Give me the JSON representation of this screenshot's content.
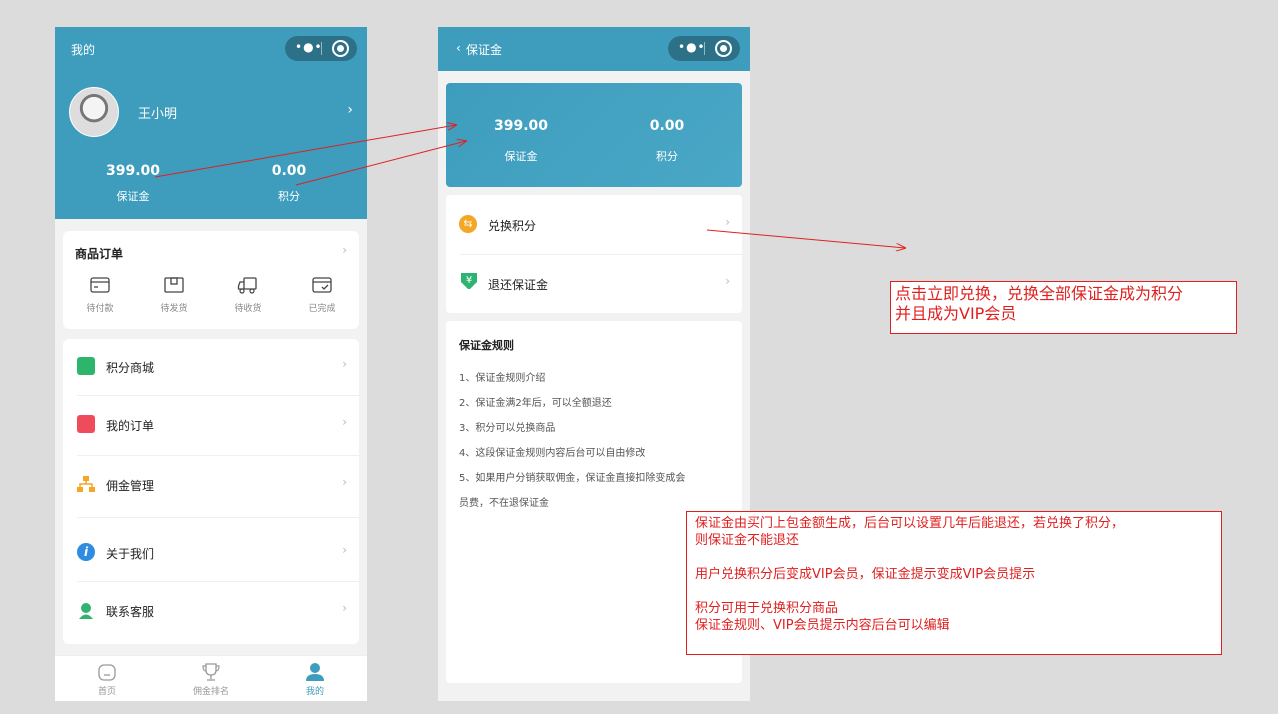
{
  "phone1": {
    "nav_title": "我的",
    "user_name": "王小明",
    "deposit_value": "399.00",
    "deposit_label": "保证金",
    "points_value": "0.00",
    "points_label": "积分",
    "orders_title": "商品订单",
    "order_items": [
      "待付款",
      "待发货",
      "待收货",
      "已完成"
    ],
    "menu": [
      {
        "label": "积分商城",
        "color": "#2db56b"
      },
      {
        "label": "我的订单",
        "color": "#ef4b5a"
      },
      {
        "label": "佣金管理",
        "color": "#f5a623"
      },
      {
        "label": "关于我们",
        "color": "#2e8de0"
      },
      {
        "label": "联系客服",
        "color": "#2fb373"
      }
    ],
    "tabs": [
      "首页",
      "佣金排名",
      "我的"
    ]
  },
  "phone2": {
    "nav_title": "保证金",
    "deposit_value": "399.00",
    "deposit_label": "保证金",
    "points_value": "0.00",
    "points_label": "积分",
    "actions": [
      {
        "label": "兑换积分",
        "color": "#f5a623"
      },
      {
        "label": "退还保证金",
        "color": "#2fb373"
      }
    ],
    "rules_title": "保证金规则",
    "rules": [
      "1、保证金规则介绍",
      "2、保证金满2年后，可以全额退还",
      "3、积分可以兑换商品",
      "4、这段保证金规则内容后台可以自由修改",
      "5、如果用户分销获取佣金，保证金直接扣除变成会",
      "员费，不在退保证金"
    ]
  },
  "annotations": {
    "note1_line1": "点击立即兑换，兑换全部保证金成为积分",
    "note1_line2": "并且成为VIP会员",
    "note2_line1": "保证金由买门上包金额生成，后台可以设置几年后能退还，若兑换了积分，",
    "note2_line2": "则保证金不能退还",
    "note2_line3": "用户兑换积分后变成VIP会员，保证金提示变成VIP会员提示",
    "note2_line4": "积分可用于兑换积分商品",
    "note2_line5": "保证金规则、VIP会员提示内容后台可以编辑"
  },
  "colors": {
    "brand": "#3e9dbd",
    "annotation": "#e02020"
  },
  "icons": [
    "more-dots-icon",
    "target-icon",
    "chevron-right-icon",
    "wallet-icon",
    "box-icon",
    "truck-icon",
    "done-box-icon",
    "bag-icon",
    "clipboard-icon",
    "org-chart-icon",
    "info-icon",
    "headset-icon",
    "home-icon",
    "trophy-icon",
    "user-icon",
    "exchange-icon",
    "yen-down-icon",
    "back-chevron-icon"
  ]
}
